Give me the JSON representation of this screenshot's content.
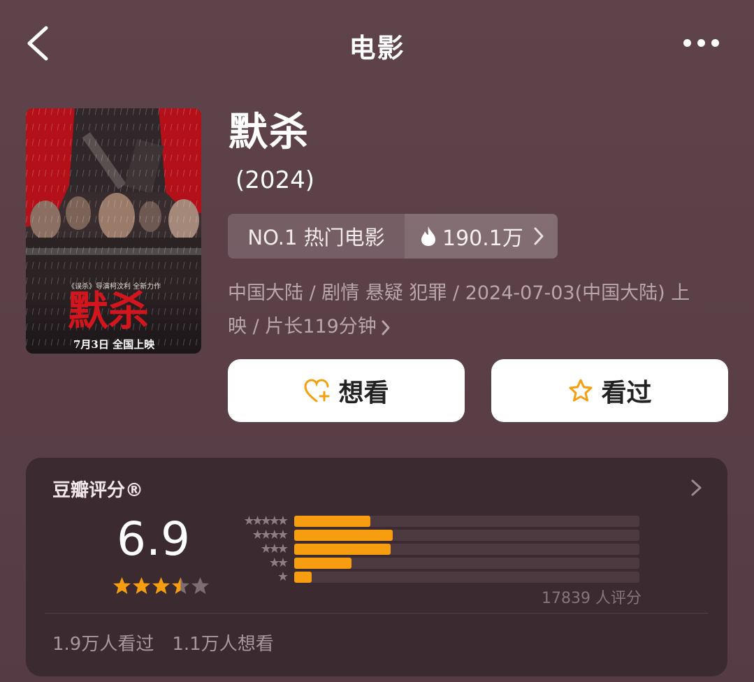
{
  "nav": {
    "title": "电影",
    "back_icon": "chevron-left-icon",
    "more_icon": "more-horizontal-icon"
  },
  "poster": {
    "title_art": "默杀",
    "tagline": "《误杀》导演柯汶利 全新力作",
    "release_line": "7月3日 全国上映"
  },
  "movie": {
    "title": "默杀",
    "year": "(2024)",
    "rank_label": "NO.1 热门电影",
    "heat": "190.1万",
    "meta_line1": "中国大陆 / 剧情 悬疑 犯罪 / 2024-07-03(中国大陆) 上",
    "meta_line2": "映 / 片长119分钟"
  },
  "actions": {
    "want": "想看",
    "seen": "看过"
  },
  "rating": {
    "title": "豆瓣评分®",
    "score": "6.9",
    "stars": 3.5,
    "distribution": [
      {
        "stars": 5,
        "fraction": 0.22
      },
      {
        "stars": 4,
        "fraction": 0.285
      },
      {
        "stars": 3,
        "fraction": 0.28
      },
      {
        "stars": 2,
        "fraction": 0.165
      },
      {
        "stars": 1,
        "fraction": 0.05
      }
    ],
    "count_text": "17839 人评分",
    "watched": "1.9万人看过",
    "wanting": "1.1万人想看"
  },
  "colors": {
    "accent": "#f79d10",
    "background": "#5a3f47",
    "card": "#3b2a2f"
  }
}
